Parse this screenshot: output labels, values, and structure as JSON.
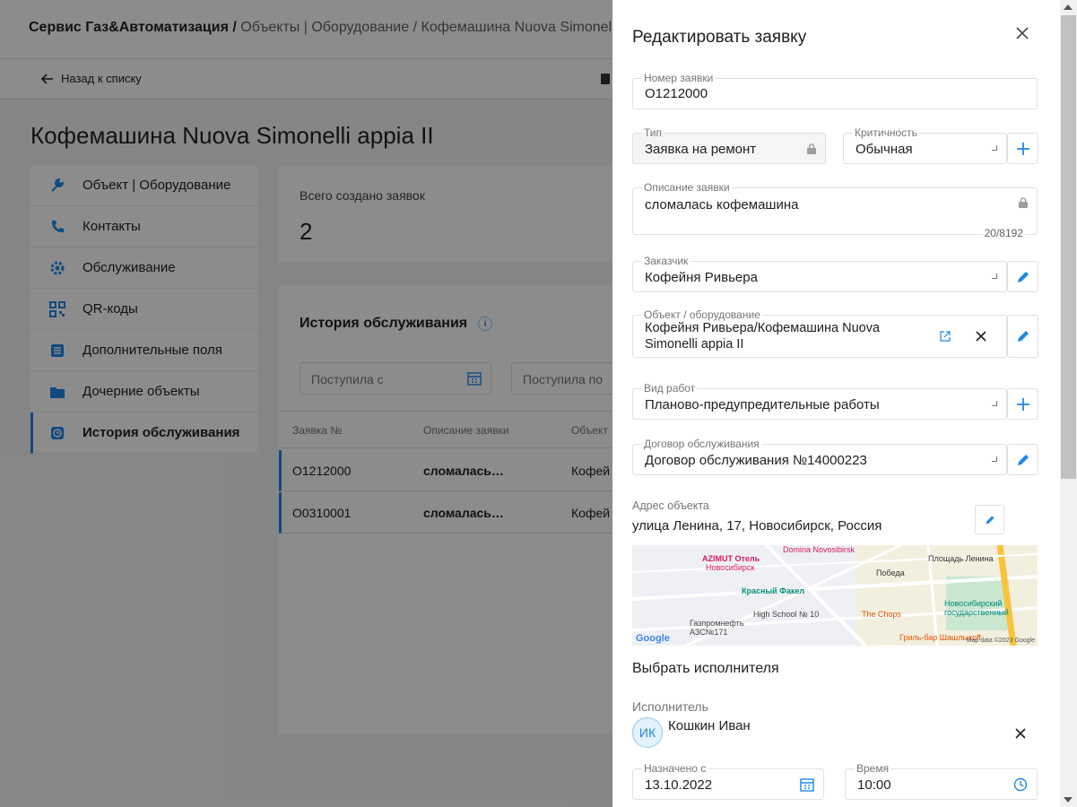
{
  "app": {
    "breadcrumb_root": "Сервис Газ&Автоматизация",
    "breadcrumb_sep": "/",
    "breadcrumb_section": "Объекты | Оборудование",
    "breadcrumb_current": "Кофемашина Nuova Simonelli appia II",
    "back_label": "Назад к списку",
    "page_title": "Кофемашина Nuova Simonelli appia II"
  },
  "sidebar": {
    "items": [
      {
        "label": "Объект | Оборудование",
        "icon": "wrench-icon"
      },
      {
        "label": "Контакты",
        "icon": "phone-icon"
      },
      {
        "label": "Обслуживание",
        "icon": "gear-icon"
      },
      {
        "label": "QR-коды",
        "icon": "qr-code-icon"
      },
      {
        "label": "Дополнительные поля",
        "icon": "list-icon"
      },
      {
        "label": "Дочерние объекты",
        "icon": "folder-icon"
      },
      {
        "label": "История обслуживания",
        "icon": "history-icon"
      }
    ]
  },
  "stats": {
    "total_label": "Всего создано заявок",
    "total_value": "2"
  },
  "history": {
    "title": "История обслуживания",
    "info": "i",
    "filter_from": "Поступила с",
    "filter_to": "Поступила по",
    "columns": [
      "Заявка №",
      "Описание заявки",
      "Объект"
    ],
    "rows": [
      [
        "O1212000",
        "сломалась…",
        "Кофей"
      ],
      [
        "O0310001",
        "сломалась…",
        "Кофей"
      ]
    ]
  },
  "drawer": {
    "title": "Редактировать заявку",
    "number": {
      "label": "Номер заявки",
      "value": "O1212000"
    },
    "type": {
      "label": "Тип",
      "value": "Заявка на ремонт"
    },
    "criticality": {
      "label": "Критичность",
      "value": "Обычная"
    },
    "description": {
      "label": "Описание заявки",
      "value": "сломалась кофемашина",
      "counter": "20/8192"
    },
    "customer": {
      "label": "Заказчик",
      "value": "Кофейня Ривьера"
    },
    "object": {
      "label": "Объект / оборудование",
      "line1": "Кофейня Ривьера/Кофемашина Nuova",
      "line2": "Simonelli appia II"
    },
    "work_type": {
      "label": "Вид работ",
      "value": "Планово-предупредительные работы"
    },
    "contract": {
      "label": "Договор обслуживания",
      "value": "Договор обслуживания №14000223"
    },
    "address": {
      "label": "Адрес объекта",
      "value": "улица Ленина, 17, Новосибирск, Россия"
    },
    "map": {
      "labels": [
        "Domina Novosibirsk",
        "AZIMUT Отель",
        "Новосибирск",
        "Победа",
        "Площадь Ленина",
        "Красный Факел",
        "Новосибирский",
        "государственный",
        "High School № 10",
        "The Chops",
        "Газпромнефть",
        "АЗС№171",
        "Гриль-бар Шашлыкоff"
      ],
      "google": "Google",
      "footer": "Map data ©2023 Google"
    },
    "executor_section": "Выбрать исполнителя",
    "executor": {
      "label": "Исполнитель",
      "initials": "ИК",
      "name": "Кошкин Иван"
    },
    "assigned": {
      "label": "Назначено с",
      "value": "13.10.2022"
    },
    "time": {
      "label": "Время",
      "value": "10:00"
    }
  },
  "colors": {
    "accent": "#1e88e5",
    "overlay": "rgba(0,0,0,0.45)"
  }
}
